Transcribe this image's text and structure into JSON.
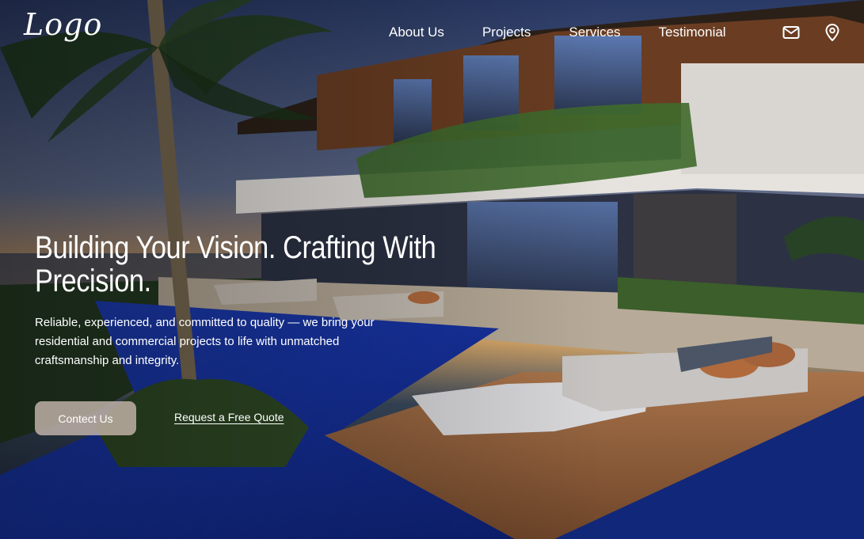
{
  "brand": {
    "logo_text": "Logo"
  },
  "nav": {
    "items": [
      {
        "label": "About Us"
      },
      {
        "label": "Projects"
      },
      {
        "label": "Services"
      },
      {
        "label": "Testimonial"
      }
    ],
    "icons": [
      "mail-icon",
      "location-pin-icon"
    ]
  },
  "hero": {
    "headline": "Building Your Vision. Crafting With Precision.",
    "subtext": "Reliable, experienced, and committed to quality — we bring your residential and commercial projects to life with unmatched craftsmanship and integrity.",
    "primary_button": "Contect Us",
    "secondary_link": "Request a Free Quote",
    "background_image": "luxury-modern-villa-with-infinity-pool-at-dusk"
  },
  "colors": {
    "text": "#ffffff",
    "button_bg": "#cdbcb2"
  }
}
